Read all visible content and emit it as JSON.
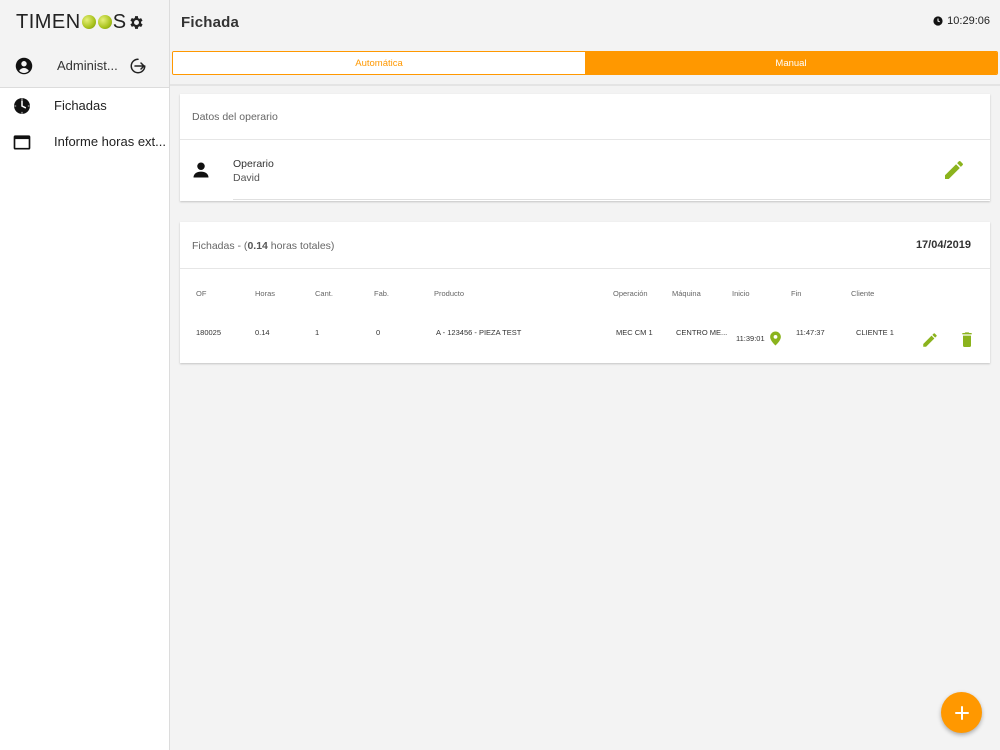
{
  "app": {
    "logo_prefix": "TIMEN",
    "logo_suffix": "S"
  },
  "sidebar": {
    "user_name": "Administ...",
    "items": [
      {
        "label": "Fichadas",
        "icon": "clock-icon"
      },
      {
        "label": "Informe horas ext...",
        "icon": "window-icon"
      }
    ]
  },
  "header": {
    "title": "Fichada",
    "time": "10:29:06"
  },
  "tabs": [
    {
      "label": "Automática",
      "active": false
    },
    {
      "label": "Manual",
      "active": true
    }
  ],
  "operator_card": {
    "title": "Datos del operario",
    "label": "Operario",
    "value": "David"
  },
  "fichadas_card": {
    "title_prefix": "Fichadas - (",
    "hours": "0.14",
    "title_suffix": " horas totales)",
    "date": "17/04/2019",
    "columns": [
      "OF",
      "Horas",
      "Cant.",
      "Fab.",
      "Producto",
      "Operación",
      "Máquina",
      "Inicio",
      "Fin",
      "Cliente"
    ],
    "rows": [
      {
        "of": "180025",
        "horas": "0.14",
        "cant": "1",
        "fab": "0",
        "producto": "A - 123456 - PIEZA TEST",
        "operacion": "MEC CM 1",
        "maquina": "CENTRO ME...",
        "inicio": "11:39:01",
        "fin": "11:47:37",
        "cliente": "CLIENTE 1"
      }
    ]
  },
  "colors": {
    "accent": "#ff9800",
    "icon_green": "#8bb31d"
  }
}
